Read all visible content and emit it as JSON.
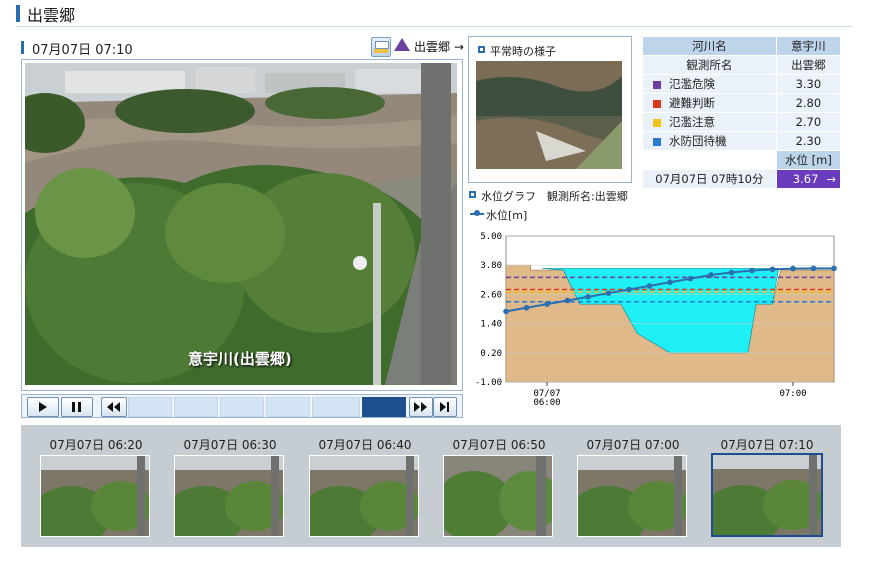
{
  "header": {
    "title": "出雲郷"
  },
  "camera": {
    "datetime": "07月07日 07:10",
    "station_link": "出雲郷 →",
    "overlay_label": "意宇川(出雲郷)"
  },
  "normal": {
    "label": "平常時の様子"
  },
  "table": {
    "river_label": "河川名",
    "river_value": "意宇川",
    "station_label": "観測所名",
    "station_value": "出雲郷",
    "levels": [
      {
        "name": "氾濫危険",
        "value": "3.30",
        "color": "#6a3fa0"
      },
      {
        "name": "避難判断",
        "value": "2.80",
        "color": "#d93a1f"
      },
      {
        "name": "氾濫注意",
        "value": "2.70",
        "color": "#f2c21a"
      },
      {
        "name": "水防団待機",
        "value": "2.30",
        "color": "#2a7ad0"
      }
    ],
    "wl_header": "水位 [m]",
    "time": "07月07日 07時10分",
    "wl_value": "3.67",
    "wl_arrow": "→"
  },
  "graph": {
    "title": "水位グラフ　観測所名:出雲郷",
    "legend": "水位[m]"
  },
  "chart_data": {
    "type": "line",
    "title": "",
    "ylabel": "水位[m]",
    "ylim": [
      -1.0,
      5.0
    ],
    "yticks": [
      "5.00",
      "3.80",
      "2.60",
      "1.40",
      "0.20",
      "-1.00"
    ],
    "xticks": [
      {
        "label": "07/07\n06:00",
        "x": 0
      },
      {
        "label": "07:00",
        "x": 60
      }
    ],
    "xlim": [
      -10,
      70
    ],
    "thresholds": [
      3.3,
      2.8,
      2.7,
      2.3
    ],
    "series": [
      {
        "name": "水位[m]",
        "x": [
          -10,
          -5,
          0,
          5,
          10,
          15,
          20,
          25,
          30,
          35,
          40,
          45,
          50,
          55,
          60,
          65,
          70
        ],
        "values": [
          1.9,
          2.05,
          2.2,
          2.35,
          2.5,
          2.65,
          2.8,
          2.95,
          3.1,
          3.25,
          3.4,
          3.5,
          3.58,
          3.63,
          3.66,
          3.67,
          3.67
        ]
      }
    ]
  },
  "thumbnails": [
    {
      "time": "07月07日 06:20"
    },
    {
      "time": "07月07日 06:30"
    },
    {
      "time": "07月07日 06:40"
    },
    {
      "time": "07月07日 06:50"
    },
    {
      "time": "07月07日 07:00"
    },
    {
      "time": "07月07日 07:10"
    }
  ]
}
